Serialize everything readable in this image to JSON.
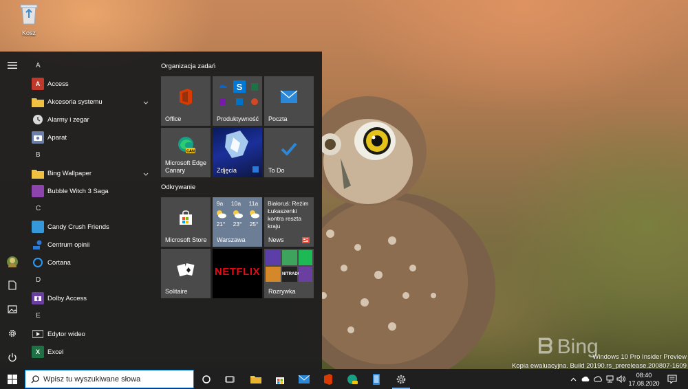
{
  "desktop": {
    "recycle_bin_label": "Kosz",
    "watermark_line1": "Windows 10 Pro Insider Preview",
    "watermark_line2": "Kopia ewaluacyjna. Build 20190.rs_prerelease.200807-1609",
    "bing_logo_text": "Bing"
  },
  "start_menu": {
    "app_list": [
      {
        "type": "letter",
        "label": "A"
      },
      {
        "type": "app",
        "label": "Access",
        "icon": "access-icon",
        "color": "#c0392b"
      },
      {
        "type": "app",
        "label": "Akcesoria systemu",
        "icon": "folder-icon",
        "color": "#f0c040",
        "expandable": true
      },
      {
        "type": "app",
        "label": "Alarmy i zegar",
        "icon": "clock-icon",
        "color": "#d9d9d9"
      },
      {
        "type": "app",
        "label": "Aparat",
        "icon": "camera-icon",
        "color": "#6b7fa8"
      },
      {
        "type": "letter",
        "label": "B"
      },
      {
        "type": "app",
        "label": "Bing Wallpaper",
        "icon": "folder-icon",
        "color": "#f0c040",
        "expandable": true
      },
      {
        "type": "app",
        "label": "Bubble Witch 3 Saga",
        "icon": "game-icon",
        "color": "#8e44ad"
      },
      {
        "type": "letter",
        "label": "C"
      },
      {
        "type": "app",
        "label": "Candy Crush Friends",
        "icon": "game-icon",
        "color": "#3498db"
      },
      {
        "type": "app",
        "label": "Centrum opinii",
        "icon": "feedback-icon",
        "color": "#2b79d6"
      },
      {
        "type": "app",
        "label": "Cortana",
        "icon": "cortana-icon",
        "color": "#2b9bf4"
      },
      {
        "type": "letter",
        "label": "D"
      },
      {
        "type": "app",
        "label": "Dolby Access",
        "icon": "dolby-icon",
        "color": "#6a3fa0"
      },
      {
        "type": "letter",
        "label": "E"
      },
      {
        "type": "app",
        "label": "Edytor wideo",
        "icon": "video-editor-icon",
        "color": "#555555"
      },
      {
        "type": "app",
        "label": "Excel",
        "icon": "excel-icon",
        "color": "#1e7145"
      }
    ],
    "groups": [
      {
        "title": "Organizacja zadań"
      },
      {
        "title": "Odkrywanie"
      }
    ],
    "tiles": {
      "office": "Office",
      "produktywnosc": "Produktywność",
      "poczta": "Poczta",
      "edge": "Microsoft Edge Canary",
      "zdjecia": "Zdjęcia",
      "todo": "To Do",
      "store": "Microsoft Store",
      "weather": {
        "label": "Warszawa",
        "hours": [
          "9a",
          "10a",
          "11a"
        ],
        "temps": [
          "21°",
          "23°",
          "25°"
        ]
      },
      "news": {
        "headline": "Białoruś: Reżim Łukaszenki kontra reszta kraju",
        "label": "News"
      },
      "solitaire": "Solitaire",
      "netflix": "NETFLIX",
      "rozrywka": "Rozrywka",
      "nitrado": "NITRADO"
    },
    "colors": {
      "tile_bg": "#4a4a4a",
      "accent": "#0078d7",
      "netflix_red": "#e50914"
    }
  },
  "taskbar": {
    "search_placeholder": "Wpisz tu wyszukiwane słowa",
    "time": "08:40",
    "date": "17.08.2020"
  }
}
